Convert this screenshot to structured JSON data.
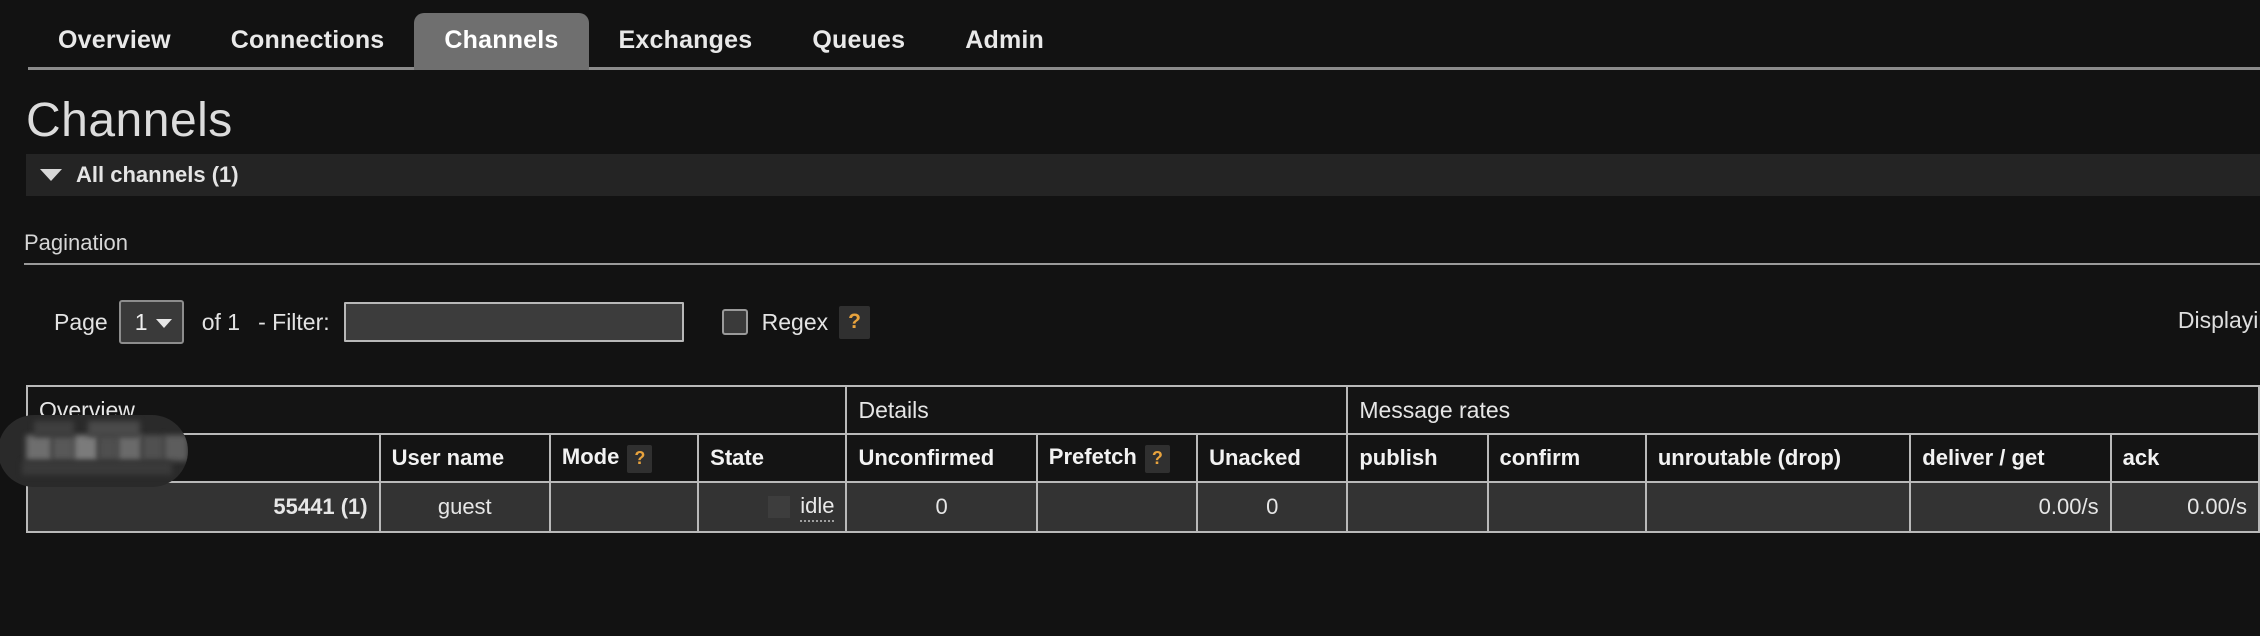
{
  "nav": {
    "tabs": [
      {
        "label": "Overview",
        "active": false
      },
      {
        "label": "Connections",
        "active": false
      },
      {
        "label": "Channels",
        "active": true
      },
      {
        "label": "Exchanges",
        "active": false
      },
      {
        "label": "Queues",
        "active": false
      },
      {
        "label": "Admin",
        "active": false
      }
    ]
  },
  "page": {
    "title": "Channels",
    "section_label": "All channels (1)",
    "caret_icon": "chevron-down-icon"
  },
  "pagination": {
    "heading": "Pagination",
    "page_label": "Page",
    "page_value": "1",
    "page_options": [
      "1"
    ],
    "of_label": "of 1",
    "filter_label": "- Filter:",
    "filter_value": "",
    "filter_placeholder": "",
    "regex_label": "Regex",
    "regex_checked": false,
    "regex_help": "?",
    "displaying_label": "Displaying"
  },
  "table": {
    "group_headers": [
      {
        "label": "Overview",
        "span": 4
      },
      {
        "label": "Details",
        "span": 3
      },
      {
        "label": "Message rates",
        "span": 5
      }
    ],
    "columns": [
      {
        "label": "Channel",
        "align": "left"
      },
      {
        "label": "User name",
        "align": "left"
      },
      {
        "label": "Mode",
        "align": "left",
        "help": "?"
      },
      {
        "label": "State",
        "align": "left"
      },
      {
        "label": "Unconfirmed",
        "align": "left"
      },
      {
        "label": "Prefetch",
        "align": "left",
        "help": "?"
      },
      {
        "label": "Unacked",
        "align": "left"
      },
      {
        "label": "publish",
        "align": "left"
      },
      {
        "label": "confirm",
        "align": "left"
      },
      {
        "label": "unroutable (drop)",
        "align": "left"
      },
      {
        "label": "deliver / get",
        "align": "left"
      },
      {
        "label": "ack",
        "align": "left"
      }
    ],
    "rows": [
      {
        "channel": "55441 (1)",
        "user_name": "guest",
        "mode": "",
        "state": "idle",
        "unconfirmed": "0",
        "prefetch": "",
        "unacked": "0",
        "publish": "",
        "confirm": "",
        "unroutable_drop": "",
        "deliver_get": "0.00/s",
        "ack": "0.00/s"
      }
    ]
  },
  "colors": {
    "background": "#121212",
    "active_tab": "#6f6f6f",
    "row_background": "#333333",
    "border": "#b9b9b9",
    "help_accent": "#e8a33d"
  }
}
